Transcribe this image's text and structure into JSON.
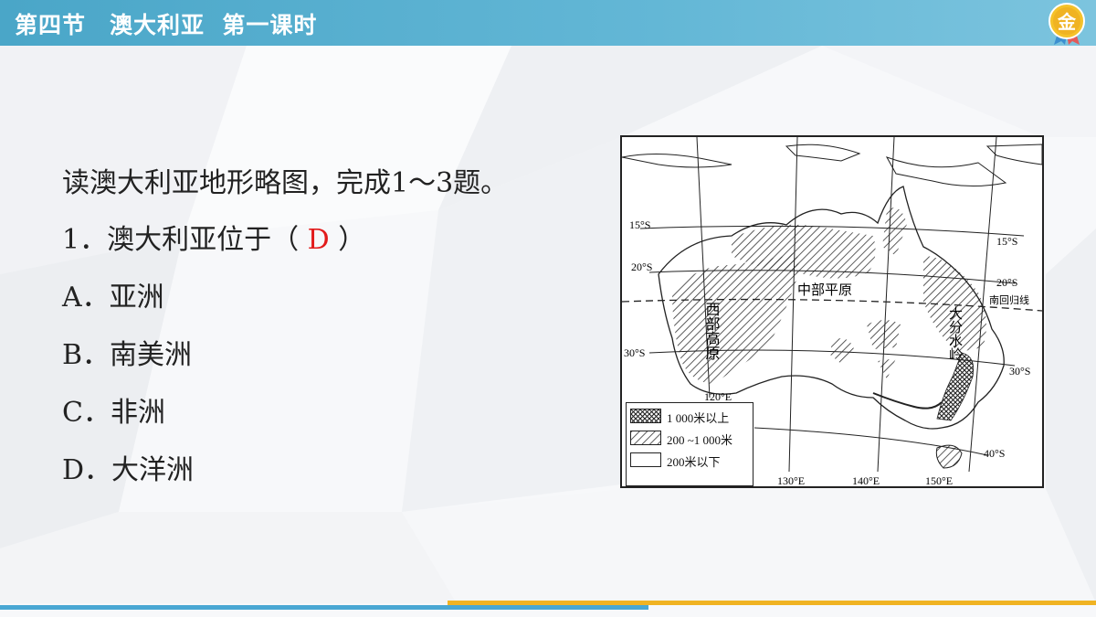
{
  "header": {
    "title": "第四节　澳大利亚  第一课时",
    "badge": "金"
  },
  "question": {
    "intro": "读澳大利亚地形略图，完成1～3题。",
    "q1_prefix": "1．澳大利亚位于（ ",
    "q1_answer": "D",
    "q1_suffix": " ）",
    "options": [
      "A．亚洲",
      "B．南美洲",
      "C．非洲",
      "D．大洋洲"
    ]
  },
  "map": {
    "lat_labels": [
      "15°S",
      "20°S",
      "30°S",
      "15°S",
      "20°S",
      "30°S",
      "40°S"
    ],
    "lon_labels": [
      "120°E",
      "130°E",
      "140°E",
      "150°E"
    ],
    "region_labels": [
      "西部高原",
      "中部平原",
      "大分水岭"
    ],
    "tropic_label": "南回归线",
    "legend": [
      "1 000米以上",
      "200 ~1 000米",
      "200米以下"
    ]
  },
  "colors": {
    "header": "#4aa6c8",
    "answer": "#e21b1b",
    "badge": "#f0b323"
  }
}
